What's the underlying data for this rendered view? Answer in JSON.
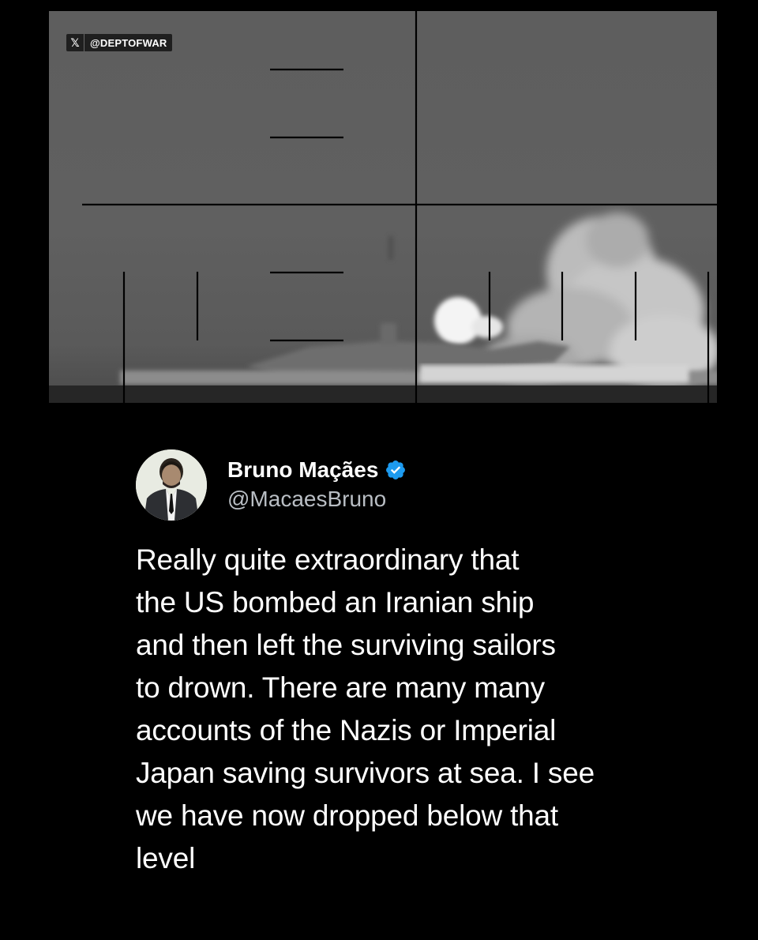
{
  "video": {
    "watermark_handle": "@DEPTOFWAR",
    "watermark_icon": "x-logo-icon"
  },
  "tweet": {
    "author": {
      "display_name": "Bruno Maçães",
      "username": "@MacaesBruno",
      "verified": true,
      "verified_color": "#1d9bf0"
    },
    "text": "Really quite extraordinary that\nthe US bombed an Iranian ship\nand then left the surviving sailors\nto drown. There are many many\naccounts of the Nazis or Imperial\nJapan saving survivors at sea. I see\nwe have now dropped below that\nlevel"
  },
  "colors": {
    "background": "#000000",
    "text": "#ffffff",
    "muted_text": "#b9bec4"
  }
}
